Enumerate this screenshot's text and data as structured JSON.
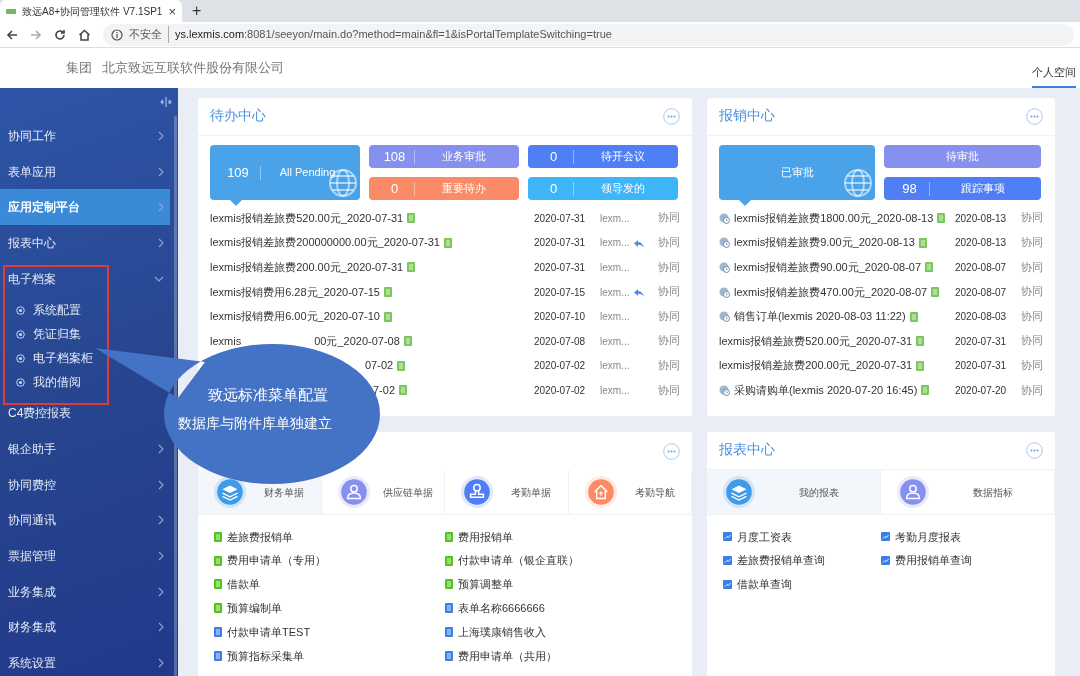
{
  "browser": {
    "tab_title": "致远A8+协同管理软件 V7.1SP1",
    "tab_close": "×",
    "new_tab": "+",
    "security": "不安全",
    "url_host": "ys.lexmis.com",
    "url_rest": ":8081/seeyon/main.do?method=main&fl=1&isPortalTemplateSwitching=true"
  },
  "header": {
    "group": "集团",
    "company": "北京致远互联软件股份有限公司",
    "space_tab": {
      "label": "个人空间",
      "selected": true
    }
  },
  "sidebar": {
    "items": [
      {
        "label": "协同工作",
        "kind": "group",
        "selected": false,
        "expanded": false
      },
      {
        "label": "表单应用",
        "kind": "group",
        "selected": false,
        "expanded": false
      },
      {
        "label": "应用定制平台",
        "kind": "group",
        "selected": true,
        "expanded": false
      },
      {
        "label": "报表中心",
        "kind": "group",
        "selected": false,
        "expanded": false
      },
      {
        "label": "电子档案",
        "kind": "group",
        "selected": false,
        "expanded": true,
        "children": [
          {
            "label": "系统配置"
          },
          {
            "label": "凭证归集"
          },
          {
            "label": "电子档案柜"
          },
          {
            "label": "我的借阅"
          }
        ]
      },
      {
        "label": "C4费控报表",
        "kind": "leaf",
        "selected": false,
        "expanded": false
      },
      {
        "label": "银企助手",
        "kind": "group",
        "selected": false,
        "expanded": false
      },
      {
        "label": "协同费控",
        "kind": "group",
        "selected": false,
        "expanded": false
      },
      {
        "label": "协同通讯",
        "kind": "group",
        "selected": false,
        "expanded": false
      },
      {
        "label": "票据管理",
        "kind": "group",
        "selected": false,
        "expanded": false
      },
      {
        "label": "业务集成",
        "kind": "group",
        "selected": false,
        "expanded": false
      },
      {
        "label": "财务集成",
        "kind": "group",
        "selected": false,
        "expanded": false
      },
      {
        "label": "系统设置",
        "kind": "group",
        "selected": false,
        "expanded": false
      }
    ]
  },
  "todo": {
    "title": "待办中心",
    "main_tile": {
      "count": "109",
      "label": "All Pending"
    },
    "tiles": [
      {
        "count": "108",
        "label": "业务审批",
        "color": "#8690ee"
      },
      {
        "count": "0",
        "label": "待开会议",
        "color": "#4f7ef5"
      },
      {
        "count": "0",
        "label": "重要待办",
        "color": "#fb8b66"
      },
      {
        "count": "0",
        "label": "领导发的",
        "color": "#3db5f8"
      }
    ],
    "rows": [
      {
        "kind": "full",
        "title": "lexmis报销差旅费520.00元_2020-07-31",
        "date": "2020-07-31",
        "author": "lexm...",
        "replied": false,
        "type": "协同"
      },
      {
        "kind": "full",
        "title": "lexmis报销差旅费200000000.00元_2020-07-31",
        "date": "2020-07-31",
        "author": "lexm...",
        "replied": true,
        "type": "协同"
      },
      {
        "kind": "full",
        "title": "lexmis报销差旅费200.00元_2020-07-31",
        "date": "2020-07-31",
        "author": "lexm...",
        "replied": false,
        "type": "协同"
      },
      {
        "kind": "full",
        "title": "lexmis报销费用6.28元_2020-07-15",
        "date": "2020-07-15",
        "author": "lexm...",
        "replied": true,
        "type": "协同"
      },
      {
        "kind": "full",
        "title": "lexmis报销费用6.00元_2020-07-10",
        "date": "2020-07-10",
        "author": "lexm...",
        "replied": false,
        "type": "协同"
      },
      {
        "kind": "covered",
        "title_head": "lexmis",
        "title": "00元_2020-07-08",
        "date": "2020-07-08",
        "author": "lexm...",
        "replied": false,
        "type": "协同"
      },
      {
        "kind": "covered",
        "title": "07-02",
        "date": "2020-07-02",
        "author": "lexm...",
        "replied": false,
        "type": "协同"
      },
      {
        "kind": "covered",
        "title": "7-02",
        "date": "2020-07-02",
        "author": "lexm...",
        "replied": false,
        "type": "协同"
      }
    ]
  },
  "reimburse": {
    "title": "报销中心",
    "main_tile": {
      "label": "已审批"
    },
    "tiles": [
      {
        "label": "待审批",
        "color": "#8690ee"
      },
      {
        "count": "98",
        "label": "跟踪事项",
        "color": "#4f7ef5"
      }
    ],
    "rows": [
      {
        "has_icon": true,
        "title": "lexmis报销差旅费1800.00元_2020-08-13",
        "date": "2020-08-13",
        "type": "协同"
      },
      {
        "has_icon": true,
        "title": "lexmis报销差旅费9.00元_2020-08-13",
        "date": "2020-08-13",
        "type": "协同"
      },
      {
        "has_icon": true,
        "title": "lexmis报销差旅费90.00元_2020-08-07",
        "date": "2020-08-07",
        "type": "协同"
      },
      {
        "has_icon": true,
        "title": "lexmis报销差旅费470.00元_2020-08-07",
        "date": "2020-08-07",
        "type": "协同"
      },
      {
        "has_icon": true,
        "title": "销售订单(lexmis 2020-08-03 11:22)",
        "date": "2020-08-03",
        "type": "协同"
      },
      {
        "has_icon": false,
        "title": "lexmis报销差旅费520.00元_2020-07-31",
        "date": "2020-07-31",
        "type": "协同"
      },
      {
        "has_icon": false,
        "title": "lexmis报销差旅费200.00元_2020-07-31",
        "date": "2020-07-31",
        "type": "协同"
      },
      {
        "has_icon": true,
        "title": "采购请购单(lexmis 2020-07-20 16:45)",
        "date": "2020-07-20",
        "type": "协同"
      }
    ]
  },
  "forms": {
    "tabs": [
      {
        "label": "财务单据",
        "kind": "layers",
        "color": "#3d9be9",
        "selected": true
      },
      {
        "label": "供应链单据",
        "kind": "people",
        "color": "#8690ee",
        "selected": false
      },
      {
        "label": "考勤单据",
        "kind": "stamp",
        "color": "#4f7ef5",
        "selected": false
      },
      {
        "label": "考勤导航",
        "kind": "house",
        "color": "#fb8b66",
        "selected": false
      }
    ],
    "items": [
      {
        "label": "差旅费报销单",
        "color": "#52c41a"
      },
      {
        "label": "费用报销单",
        "color": "#52c41a"
      },
      {
        "label": "费用申请单（专用）",
        "color": "#52c41a"
      },
      {
        "label": "付款申请单（银企直联）",
        "color": "#52c41a"
      },
      {
        "label": "借款单",
        "color": "#52c41a"
      },
      {
        "label": "预算调整单",
        "color": "#52c41a"
      },
      {
        "label": "预算编制单",
        "color": "#52c41a"
      },
      {
        "label": "表单名称6666666",
        "color": "#3d7ee8"
      },
      {
        "label": "付款申请单TEST",
        "color": "#3d7ee8"
      },
      {
        "label": "上海璞康销售收入",
        "color": "#3d7ee8"
      },
      {
        "label": "预算指标采集单",
        "color": "#3d7ee8"
      },
      {
        "label": "费用申请单（共用）",
        "color": "#3d7ee8"
      }
    ]
  },
  "reports": {
    "title": "报表中心",
    "tabs": [
      {
        "label": "我的报表",
        "kind": "layers",
        "color": "#3d9be9",
        "selected": true
      },
      {
        "label": "数据指标",
        "kind": "people",
        "color": "#8690ee",
        "selected": false
      }
    ],
    "items": [
      {
        "label": "月度工资表"
      },
      {
        "label": "考勤月度报表"
      },
      {
        "label": "差旅费报销单查询"
      },
      {
        "label": "费用报销单查询"
      },
      {
        "label": "借款单查询"
      }
    ]
  },
  "callout": {
    "lines": [
      "致远标准菜单配置",
      "数据库与附件库单独建立"
    ]
  }
}
